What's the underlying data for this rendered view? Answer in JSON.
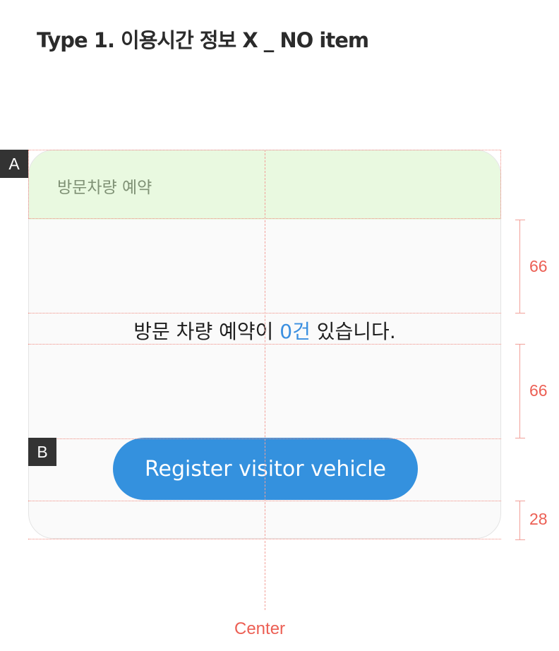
{
  "page_title": "Type 1. 이용시간 정보 X _ NO item",
  "card": {
    "header_title": "방문차량 예약",
    "empty_message": {
      "before": "방문 차량 예약이 ",
      "count": "0건",
      "after": " 있습니다."
    },
    "register_button_label": "Register visitor vehicle"
  },
  "annotations": {
    "marker_a": "A",
    "marker_b": "B",
    "spacing_1": "66",
    "spacing_2": "66",
    "spacing_3": "28",
    "center_label": "Center"
  },
  "colors": {
    "header_bg": "#e9f9e0",
    "accent_blue": "#3491de",
    "guide_red": "#ec5f54"
  }
}
